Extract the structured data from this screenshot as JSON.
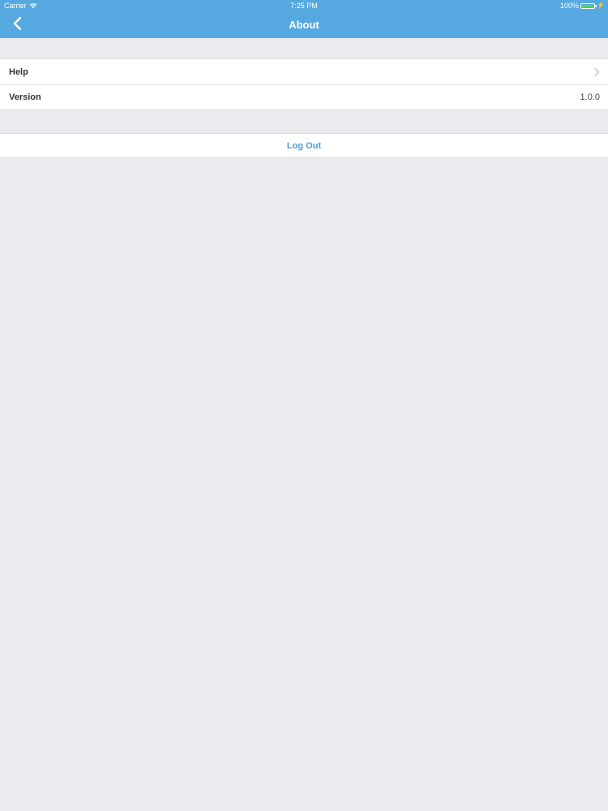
{
  "status_bar": {
    "carrier": "Carrier",
    "time": "7:25 PM",
    "battery_percent": "100%",
    "battery_level": 1.0,
    "icons": [
      "wifi-icon",
      "battery-icon",
      "charging-icon"
    ]
  },
  "nav": {
    "title": "About",
    "back_icon": "chevron-left-icon",
    "background_color": "#56a8e1"
  },
  "settings": {
    "rows": [
      {
        "label": "Help",
        "accessory": "chevron-right-icon"
      },
      {
        "label": "Version",
        "value": "1.0.0"
      }
    ]
  },
  "actions": {
    "logout_label": "Log Out",
    "logout_color": "#4b9fd6"
  },
  "colors": {
    "background": "#ebeaef",
    "cell": "#ffffff"
  }
}
